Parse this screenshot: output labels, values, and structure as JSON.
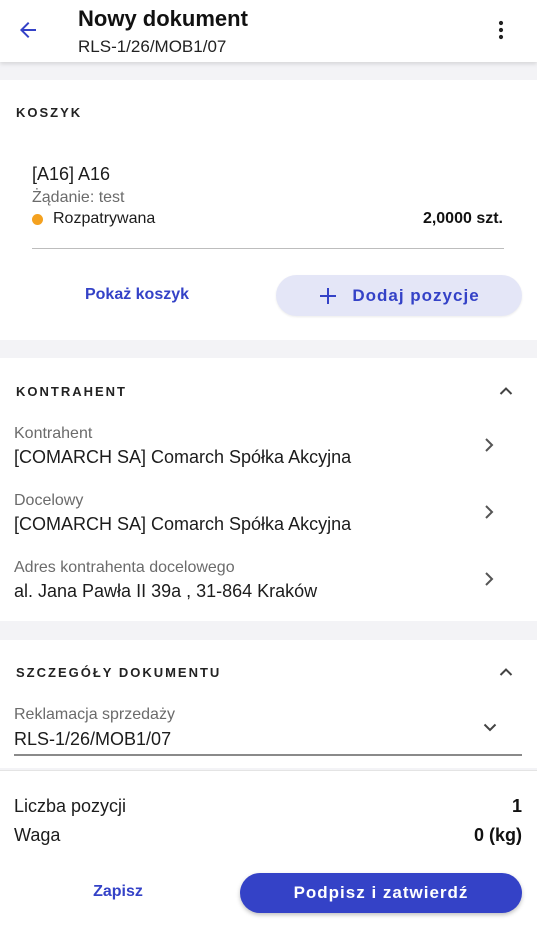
{
  "header": {
    "title": "Nowy dokument",
    "subtitle": "RLS-1/26/MOB1/07",
    "back_icon": "arrow-left-icon",
    "menu_icon": "more-vertical-icon",
    "accent": "#3442c7"
  },
  "cart": {
    "section_title": "KOSZYK",
    "item": {
      "name": "[A16] A16",
      "request": "Żądanie: test",
      "status": "Rozpatrywana",
      "status_color": "#f4a11f",
      "quantity": "2,0000 szt."
    },
    "show_cart_label": "Pokaż koszyk",
    "add_items_label": "Dodaj pozycje"
  },
  "contractor": {
    "section_title": "KONTRAHENT",
    "rows": [
      {
        "label": "Kontrahent",
        "value": "[COMARCH SA] Comarch Spółka Akcyjna"
      },
      {
        "label": "Docelowy",
        "value": "[COMARCH SA] Comarch Spółka Akcyjna"
      },
      {
        "label": "Adres kontrahenta docelowego",
        "value": "al. Jana Pawła II 39a , 31-864 Kraków"
      }
    ]
  },
  "document_details": {
    "section_title": "SZCZEGÓŁY DOKUMENTU",
    "field_label": "Reklamacja sprzedaży",
    "field_value": "RLS-1/26/MOB1/07"
  },
  "summary": {
    "items_count_label": "Liczba pozycji",
    "items_count_value": "1",
    "weight_label": "Waga",
    "weight_value": "0 (kg)"
  },
  "footer": {
    "save_label": "Zapisz",
    "sign_label": "Podpisz i zatwierdź"
  }
}
